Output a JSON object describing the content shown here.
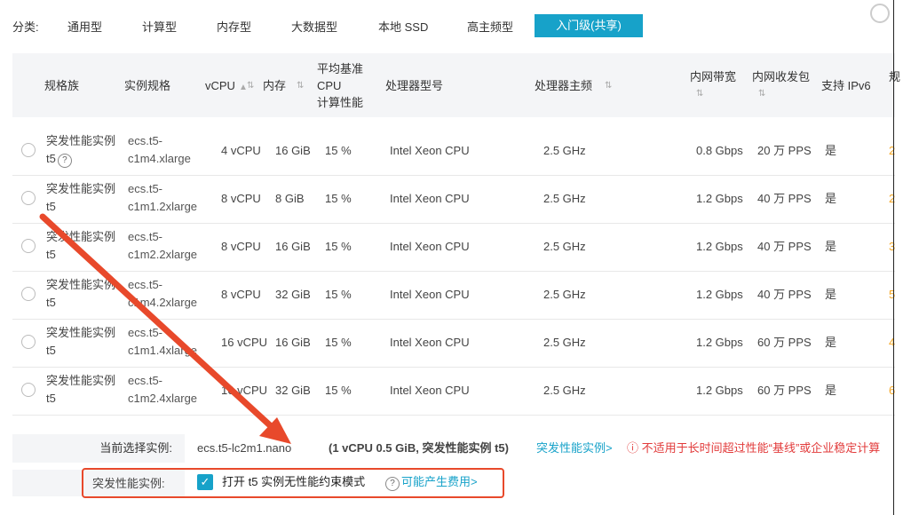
{
  "tabs": {
    "label": "分类:",
    "items": [
      "通用型",
      "计算型",
      "内存型",
      "大数据型",
      "本地 SSD",
      "高主频型",
      "入门级(共享)"
    ]
  },
  "table": {
    "headers": {
      "family": "规格族",
      "spec": "实例规格",
      "vcpu": "vCPU",
      "mem": "内存",
      "baseline": [
        "平均基准",
        "CPU",
        "计算性能"
      ],
      "cpu_model": "处理器型号",
      "freq": "处理器主频",
      "bandwidth": "内网带宽",
      "pps": "内网收发包",
      "ipv6": "支持 IPv6",
      "more": "规"
    },
    "rows": [
      {
        "family1": "突发性能实例",
        "family2": "t5",
        "spec1": "ecs.t5-",
        "spec2": "c1m4.xlarge",
        "vcpu": "4 vCPU",
        "mem": "16 GiB",
        "baseline": "15 %",
        "cpu": "Intel Xeon CPU",
        "freq": "2.5 GHz",
        "bw": "0.8 Gbps",
        "pps": "20 万 PPS",
        "ipv6": "是",
        "extra": "2"
      },
      {
        "family1": "突发性能实例",
        "family2": "t5",
        "spec1": "ecs.t5-",
        "spec2": "c1m1.2xlarge",
        "vcpu": "8 vCPU",
        "mem": "8 GiB",
        "baseline": "15 %",
        "cpu": "Intel Xeon CPU",
        "freq": "2.5 GHz",
        "bw": "1.2 Gbps",
        "pps": "40 万 PPS",
        "ipv6": "是",
        "extra": "2"
      },
      {
        "family1": "突发性能实例",
        "family2": "t5",
        "spec1": "ecs.t5-",
        "spec2": "c1m2.2xlarge",
        "vcpu": "8 vCPU",
        "mem": "16 GiB",
        "baseline": "15 %",
        "cpu": "Intel Xeon CPU",
        "freq": "2.5 GHz",
        "bw": "1.2 Gbps",
        "pps": "40 万 PPS",
        "ipv6": "是",
        "extra": "3"
      },
      {
        "family1": "突发性能实例",
        "family2": "t5",
        "spec1": "ecs.t5-",
        "spec2": "c1m4.2xlarge",
        "vcpu": "8 vCPU",
        "mem": "32 GiB",
        "baseline": "15 %",
        "cpu": "Intel Xeon CPU",
        "freq": "2.5 GHz",
        "bw": "1.2 Gbps",
        "pps": "40 万 PPS",
        "ipv6": "是",
        "extra": "5"
      },
      {
        "family1": "突发性能实例",
        "family2": "t5",
        "spec1": "ecs.t5-",
        "spec2": "c1m1.4xlarge",
        "vcpu": "16 vCPU",
        "mem": "16 GiB",
        "baseline": "15 %",
        "cpu": "Intel Xeon CPU",
        "freq": "2.5 GHz",
        "bw": "1.2 Gbps",
        "pps": "60 万 PPS",
        "ipv6": "是",
        "extra": "4"
      },
      {
        "family1": "突发性能实例",
        "family2": "t5",
        "spec1": "ecs.t5-",
        "spec2": "c1m2.4xlarge",
        "vcpu": "16 vCPU",
        "mem": "32 GiB",
        "baseline": "15 %",
        "cpu": "Intel Xeon CPU",
        "freq": "2.5 GHz",
        "bw": "1.2 Gbps",
        "pps": "60 万 PPS",
        "ipv6": "是",
        "extra": "6"
      }
    ]
  },
  "selection": {
    "label": "当前选择实例:",
    "value": "ecs.t5-lc2m1.nano",
    "detail": "(1 vCPU 0.5 GiB, 突发性能实例 t5)",
    "link": "突发性能实例>",
    "warning": "不适用于长时间超过性能“基线”或企业稳定计算"
  },
  "burst": {
    "label": "突发性能实例:",
    "checkbox_label": "打开 t5 实例无性能约束模式",
    "fee_link": "可能产生费用>"
  },
  "colors": {
    "accent": "#17a2c9",
    "annotation": "#e8492b",
    "warning": "#e23b3b"
  }
}
